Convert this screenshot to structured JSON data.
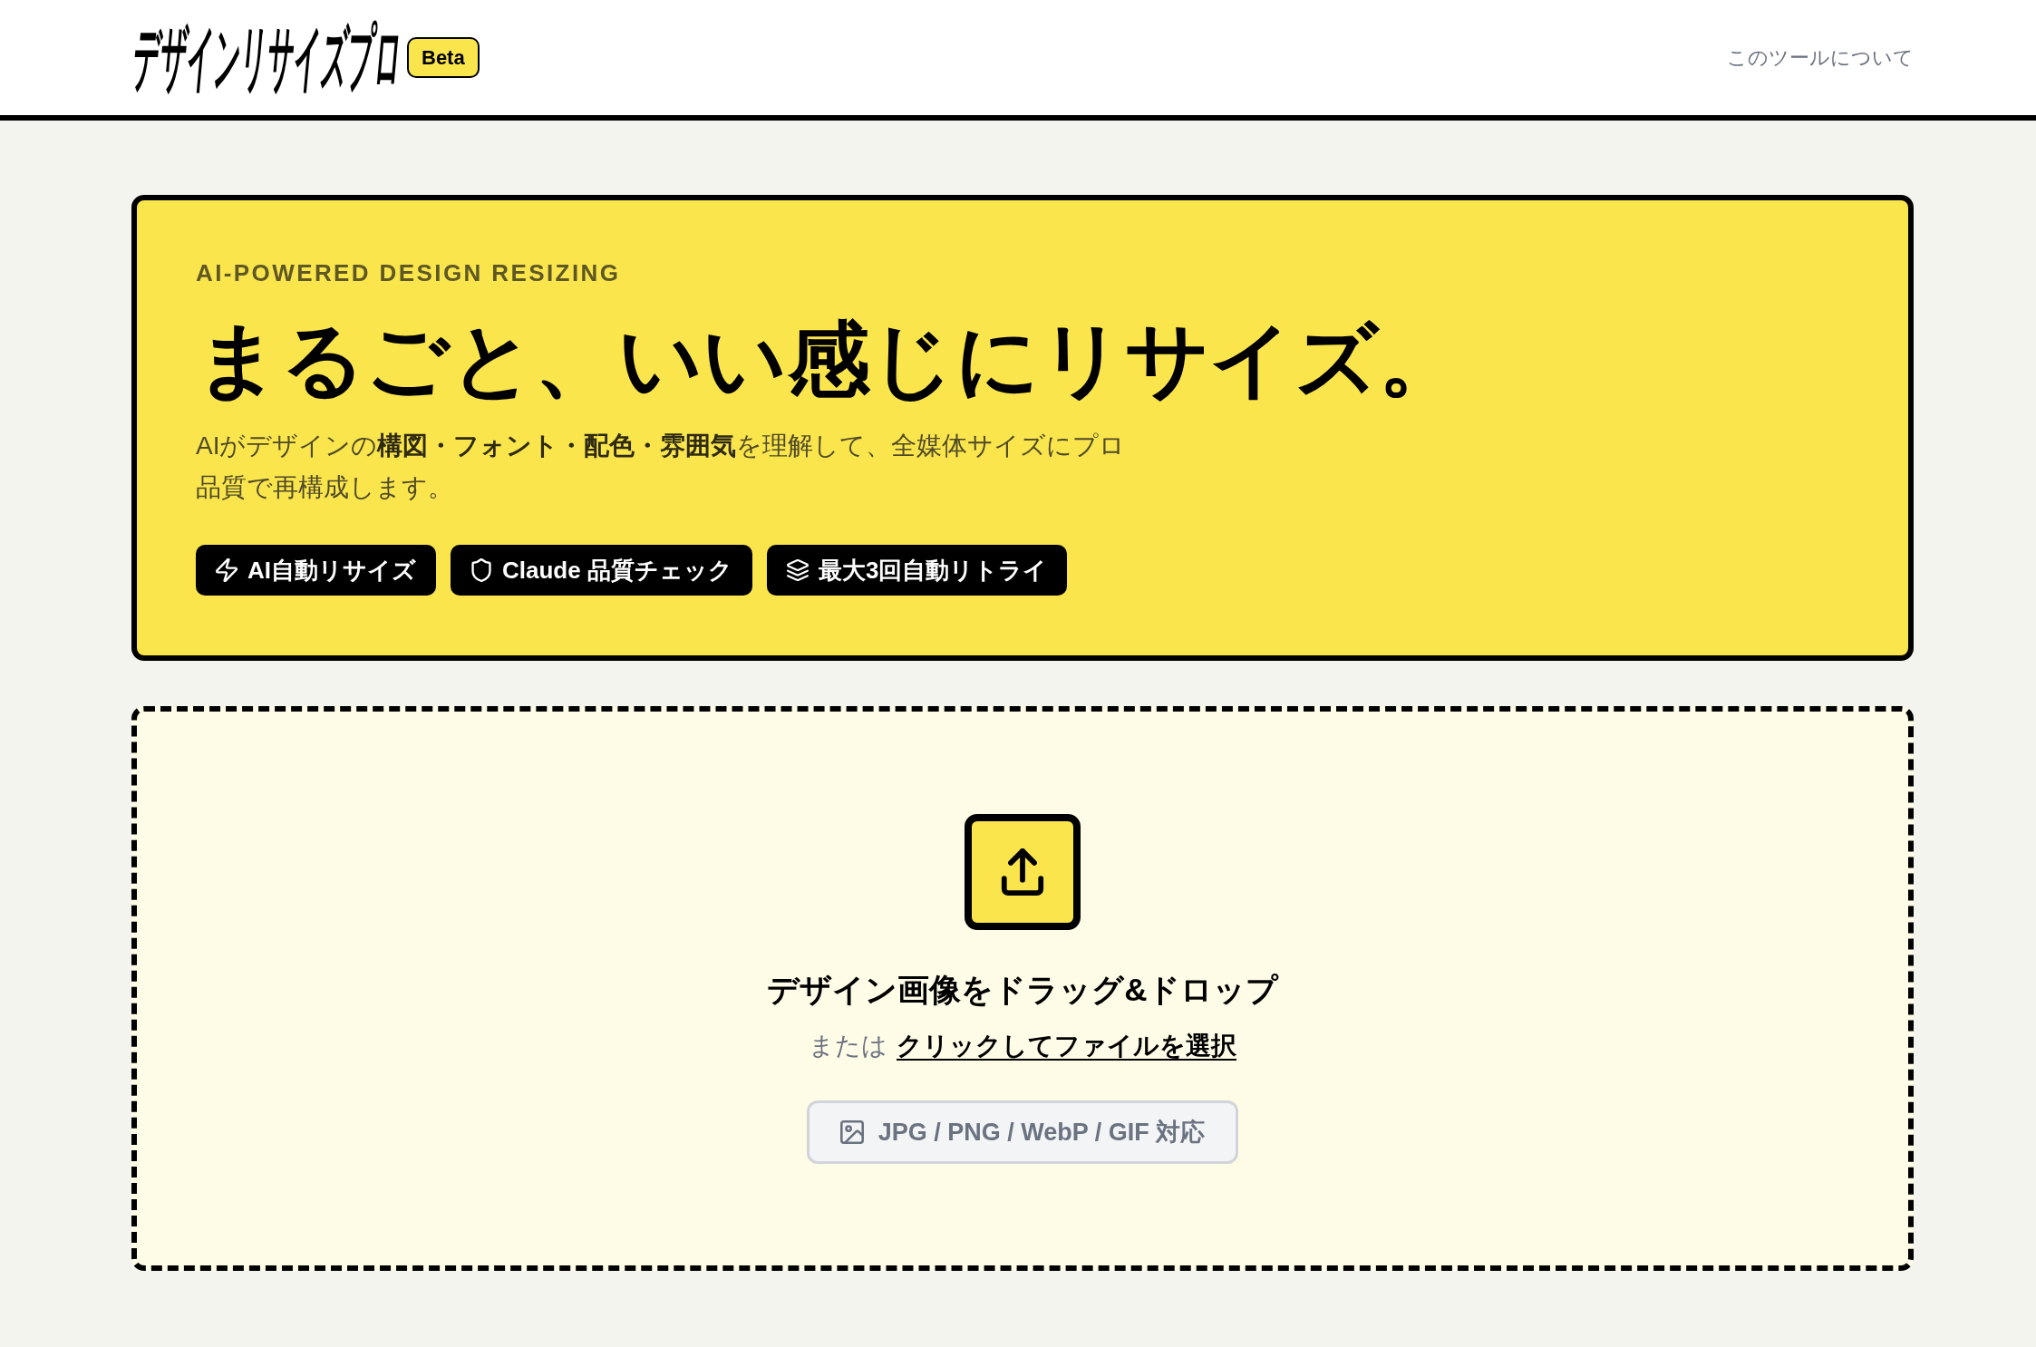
{
  "header": {
    "logo": "デザインリサイズプロ",
    "badge": "Beta",
    "nav_link": "このツールについて"
  },
  "hero": {
    "eyebrow": "AI-POWERED DESIGN RESIZING",
    "title": "まるごと、いい感じにリサイズ。",
    "description": "AIがデザインの**構図・フォント・配色・雰囲気**を理解して、全媒体サイズにプロ品質で再構成します。",
    "features": [
      "AI自動リサイズ",
      "Claude 品質チェック",
      "最大3回自動リトライ"
    ]
  },
  "dropzone": {
    "title": "デザイン画像をドラッグ&ドロップ",
    "alt_prefix": "または",
    "select_link": "クリックしてファイルを選択",
    "formats": "JPG / PNG / WebP / GIF 対応"
  }
}
